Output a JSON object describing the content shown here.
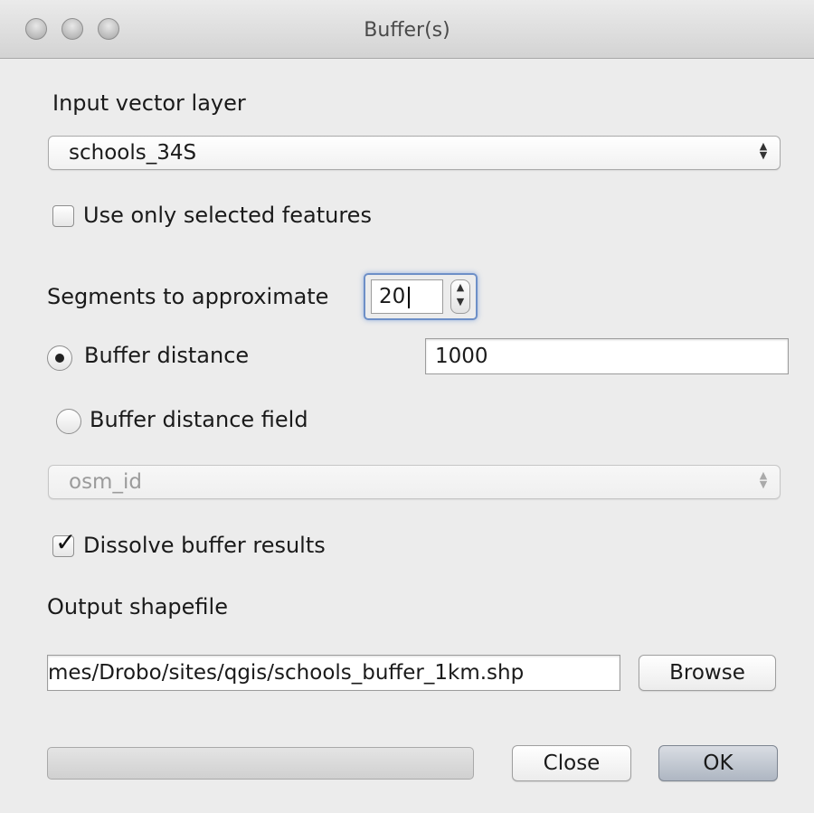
{
  "window": {
    "title": "Buffer(s)"
  },
  "input_layer": {
    "label": "Input vector layer",
    "value": "schools_34S"
  },
  "selected_only": {
    "label": "Use only selected features",
    "checked": false
  },
  "segments": {
    "label": "Segments to approximate",
    "value": "20"
  },
  "buffer_distance": {
    "label": "Buffer distance",
    "value": "1000",
    "selected": true
  },
  "buffer_distance_field": {
    "label": "Buffer distance field",
    "value": "osm_id",
    "selected": false
  },
  "dissolve": {
    "label": "Dissolve buffer results",
    "checked": true
  },
  "output": {
    "label": "Output shapefile",
    "path": "mes/Drobo/sites/qgis/schools_buffer_1km.shp",
    "browse_label": "Browse"
  },
  "buttons": {
    "close_label": "Close",
    "ok_label": "OK"
  },
  "progress": {
    "value": 0
  }
}
